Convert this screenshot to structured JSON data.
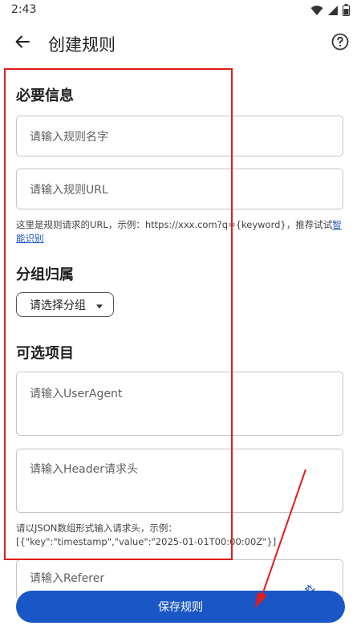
{
  "status_bar": {
    "time": "2:43"
  },
  "app_bar": {
    "title": "创建规则"
  },
  "sections": {
    "required": "必要信息",
    "group": "分组归属",
    "optional": "可选项目"
  },
  "fields": {
    "rule_name_placeholder": "请输入规则名字",
    "rule_url_placeholder": "请输入规则URL",
    "user_agent_placeholder": "请输入UserAgent",
    "header_placeholder": "请输入Header请求头",
    "referer_placeholder": "请输入Referer"
  },
  "helpers": {
    "url_hint_prefix": "这里是规则请求的URL，示例：https://xxx.com?q={keyword}，推荐试试",
    "url_hint_link": "智能识别",
    "header_hint_line1": "请以JSON数组形式输入请求头，示例：",
    "header_hint_line2": "[{\"key\":\"timestamp\",\"value\":\"2025-01-01T00:00:00Z\"}]"
  },
  "group_select": {
    "value": "请选择分组"
  },
  "save_button": {
    "label": "保存规则"
  },
  "watermark": {
    "text": "软件计"
  },
  "colors": {
    "primary": "#1a57c6",
    "annotation": "#e21c1c"
  },
  "icons": {
    "back": "arrow-left-icon",
    "help": "help-circle-icon",
    "caret": "caret-down-icon",
    "wifi": "wifi-icon",
    "signal": "signal-icon",
    "battery": "battery-icon"
  }
}
